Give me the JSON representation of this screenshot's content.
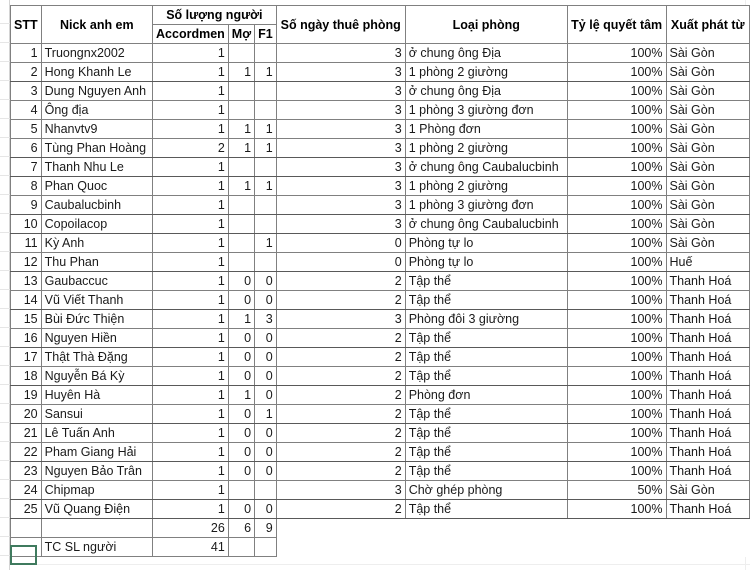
{
  "document": {
    "type": "spreadsheet",
    "accent_total_color": "#c00000",
    "grid_line_color": "#808080"
  },
  "header": {
    "col_stt": "STT",
    "col_nick": "Nick anh em",
    "group_people": "Số lượng người",
    "sub_accordmen": "Accordmen",
    "sub_mo": "Mợ",
    "sub_f1": "F1",
    "col_days": "Số ngày thuê phòng",
    "col_room": "Loại phòng",
    "col_rate": "Tỷ lệ quyết tâm",
    "col_from": "Xuất phát từ"
  },
  "rows": [
    {
      "stt": "1",
      "nick": "Truongnx2002",
      "accordmen": "1",
      "mo": "",
      "f1": "",
      "days": "3",
      "room": "ở chung ông Địa",
      "rate": "100%",
      "from": "Sài Gòn"
    },
    {
      "stt": "2",
      "nick": "Hong Khanh Le",
      "accordmen": "1",
      "mo": "1",
      "f1": "1",
      "days": "3",
      "room": "1 phòng 2 giường",
      "rate": "100%",
      "from": "Sài Gòn"
    },
    {
      "stt": "3",
      "nick": "Dung Nguyen Anh",
      "accordmen": "1",
      "mo": "",
      "f1": "",
      "days": "3",
      "room": "ở chung ông Địa",
      "rate": "100%",
      "from": "Sài Gòn"
    },
    {
      "stt": "4",
      "nick": "Ông địa",
      "accordmen": "1",
      "mo": "",
      "f1": "",
      "days": "3",
      "room": "1 phòng 3 giường đơn",
      "rate": "100%",
      "from": "Sài Gòn"
    },
    {
      "stt": "5",
      "nick": "Nhanvtv9",
      "accordmen": "1",
      "mo": "1",
      "f1": "1",
      "days": "3",
      "room": "1 Phòng đơn",
      "rate": "100%",
      "from": "Sài Gòn"
    },
    {
      "stt": "6",
      "nick": "Tùng Phan Hoàng",
      "accordmen": "2",
      "mo": "1",
      "f1": "1",
      "days": "3",
      "room": "1 phòng 2 giường",
      "rate": "100%",
      "from": "Sài Gòn"
    },
    {
      "stt": "7",
      "nick": "Thanh Nhu Le",
      "accordmen": "1",
      "mo": "",
      "f1": "",
      "days": "3",
      "room": "ở chung ông Caubalucbinh",
      "rate": "100%",
      "from": "Sài Gòn"
    },
    {
      "stt": "8",
      "nick": "Phan Quoc",
      "accordmen": "1",
      "mo": "1",
      "f1": "1",
      "days": "3",
      "room": "1 phòng 2 giường",
      "rate": "100%",
      "from": "Sài Gòn"
    },
    {
      "stt": "9",
      "nick": "Caubalucbinh",
      "accordmen": "1",
      "mo": "",
      "f1": "",
      "days": "3",
      "room": "1 phòng 3 giường đơn",
      "rate": "100%",
      "from": "Sài Gòn"
    },
    {
      "stt": "10",
      "nick": "Copoilacop",
      "accordmen": "1",
      "mo": "",
      "f1": "",
      "days": "3",
      "room": "ở chung ông Caubalucbinh",
      "rate": "100%",
      "from": "Sài Gòn"
    },
    {
      "stt": "11",
      "nick": "Kỳ Anh",
      "accordmen": "1",
      "mo": "",
      "f1": "1",
      "days": "0",
      "room": "Phòng tự lo",
      "rate": "100%",
      "from": "Sài Gòn"
    },
    {
      "stt": "12",
      "nick": "Thu Phan",
      "accordmen": "1",
      "mo": "",
      "f1": "",
      "days": "0",
      "room": "Phòng tự lo",
      "rate": "100%",
      "from": "Huế"
    },
    {
      "stt": "13",
      "nick": "Gaubaccuc",
      "accordmen": "1",
      "mo": "0",
      "f1": "0",
      "days": "2",
      "room": "Tập thể",
      "rate": "100%",
      "from": "Thanh Hoá"
    },
    {
      "stt": "14",
      "nick": "Vũ Viết Thanh",
      "accordmen": "1",
      "mo": "0",
      "f1": "0",
      "days": "2",
      "room": "Tập thể",
      "rate": "100%",
      "from": "Thanh Hoá"
    },
    {
      "stt": "15",
      "nick": "Bùi Đức Thiện",
      "accordmen": "1",
      "mo": "1",
      "f1": "3",
      "days": "3",
      "room": "Phòng đôi 3 giường",
      "rate": "100%",
      "from": "Thanh Hoá"
    },
    {
      "stt": "16",
      "nick": "Nguyen Hiền",
      "accordmen": "1",
      "mo": "0",
      "f1": "0",
      "days": "2",
      "room": "Tập thể",
      "rate": "100%",
      "from": "Thanh Hoá"
    },
    {
      "stt": "17",
      "nick": "Thật Thà Đặng",
      "accordmen": "1",
      "mo": "0",
      "f1": "0",
      "days": "2",
      "room": "Tập thể",
      "rate": "100%",
      "from": "Thanh Hoá"
    },
    {
      "stt": "18",
      "nick": "Nguyễn Bá Kỳ",
      "accordmen": "1",
      "mo": "0",
      "f1": "0",
      "days": "2",
      "room": "Tập thể",
      "rate": "100%",
      "from": "Thanh Hoá"
    },
    {
      "stt": "19",
      "nick": "Huyên Hà",
      "accordmen": "1",
      "mo": "1",
      "f1": "0",
      "days": "2",
      "room": "Phòng đơn",
      "rate": "100%",
      "from": "Thanh Hoá"
    },
    {
      "stt": "20",
      "nick": "Sansui",
      "accordmen": "1",
      "mo": "0",
      "f1": "1",
      "days": "2",
      "room": "Tập thể",
      "rate": "100%",
      "from": "Thanh Hoá"
    },
    {
      "stt": "21",
      "nick": "Lê Tuấn Anh",
      "accordmen": "1",
      "mo": "0",
      "f1": "0",
      "days": "2",
      "room": "Tập thể",
      "rate": "100%",
      "from": "Thanh Hoá"
    },
    {
      "stt": "22",
      "nick": "Pham Giang Hải",
      "accordmen": "1",
      "mo": "0",
      "f1": "0",
      "days": "2",
      "room": "Tập thể",
      "rate": "100%",
      "from": "Thanh Hoá"
    },
    {
      "stt": "23",
      "nick": "Nguyen Bảo Trân",
      "accordmen": "1",
      "mo": "0",
      "f1": "0",
      "days": "2",
      "room": "Tập thể",
      "rate": "100%",
      "from": "Thanh Hoá"
    },
    {
      "stt": "24",
      "nick": "Chipmap",
      "accordmen": "1",
      "mo": "",
      "f1": "",
      "days": "3",
      "room": "Chờ ghép phòng",
      "rate": "50%",
      "from": "Sài Gòn"
    },
    {
      "stt": "25",
      "nick": "Vũ Quang Điện",
      "accordmen": "1",
      "mo": "0",
      "f1": "0",
      "days": "2",
      "room": "Tập thể",
      "rate": "100%",
      "from": "Thanh Hoá"
    }
  ],
  "totals": {
    "subtotal_accordmen": "26",
    "subtotal_mo": "6",
    "subtotal_f1": "9",
    "grand_label": "TC SL người",
    "grand_value": "41"
  },
  "row_headers": [
    "",
    "",
    "",
    "",
    "",
    "",
    "",
    "",
    "",
    "",
    "",
    "",
    "",
    "",
    "",
    "",
    "",
    "",
    "",
    "",
    "",
    "",
    "",
    "",
    "",
    "",
    "",
    "",
    ""
  ]
}
